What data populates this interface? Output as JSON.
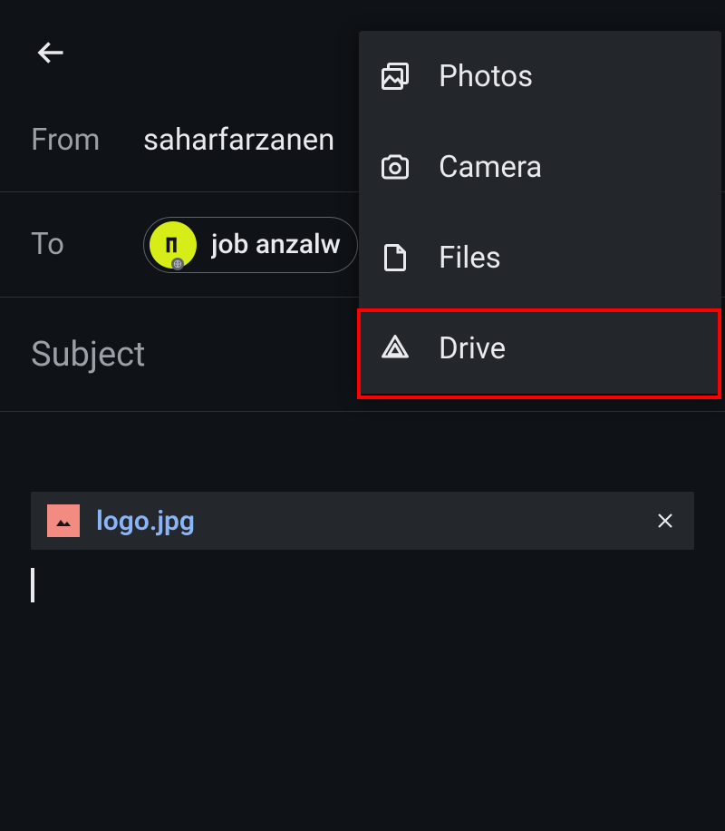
{
  "from_label": "From",
  "from_value": "saharfarzanen",
  "to_label": "To",
  "to_chip_text": "job anzalw",
  "subject_placeholder": "Subject",
  "attachment_name": "logo.jpg",
  "dropdown": {
    "photos": "Photos",
    "camera": "Camera",
    "files": "Files",
    "drive": "Drive"
  }
}
